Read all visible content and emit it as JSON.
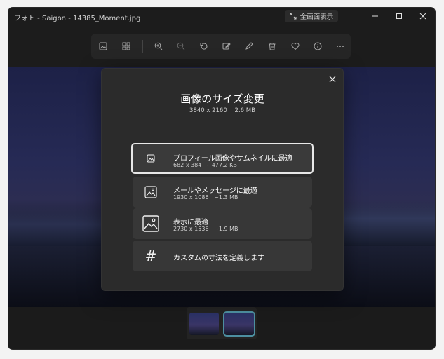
{
  "window": {
    "title": "フォト - Saigon - 14385_Moment.jpg",
    "fullscreen_label": "全画面表示"
  },
  "toolbar": {
    "buttons": [
      {
        "name": "view-icon"
      },
      {
        "name": "gallery-icon"
      },
      {
        "name": "zoom-in-icon"
      },
      {
        "name": "zoom-out-icon"
      },
      {
        "name": "rotate-icon"
      },
      {
        "name": "edit-icon"
      },
      {
        "name": "draw-icon"
      },
      {
        "name": "delete-icon"
      },
      {
        "name": "favorite-icon"
      },
      {
        "name": "info-icon"
      },
      {
        "name": "more-icon"
      }
    ]
  },
  "dialog": {
    "title": "画像のサイズ変更",
    "original": "3840 x 2160    2.6 MB",
    "options": [
      {
        "label": "プロフィール画像やサムネイルに最適",
        "dims": "682 x 384",
        "size": "~477.2 KB",
        "selected": true
      },
      {
        "label": "メールやメッセージに最適",
        "dims": "1930 x 1086",
        "size": "~1.3 MB",
        "selected": false
      },
      {
        "label": "表示に最適",
        "dims": "2730 x 1536",
        "size": "~1.9 MB",
        "selected": false
      },
      {
        "label": "カスタムの寸法を定義します",
        "icon_glyph": "#"
      }
    ]
  },
  "colors": {
    "accent": "#4d8fa0",
    "dialog_bg": "#2b2b2b",
    "option_bg": "#373737"
  }
}
